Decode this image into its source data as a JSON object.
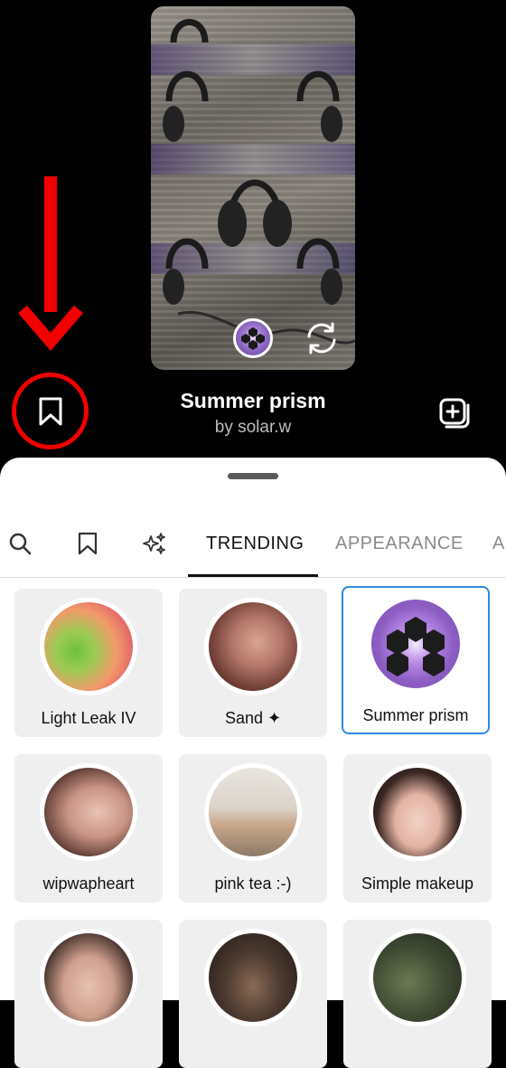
{
  "effect": {
    "title": "Summer prism",
    "author": "by solar.w"
  },
  "tabs": {
    "trending": "TRENDING",
    "appearance": "APPEARANCE",
    "partial": "A"
  },
  "tiles": [
    {
      "label": "Light Leak IV",
      "selected": false
    },
    {
      "label": "Sand ✦",
      "selected": false
    },
    {
      "label": "Summer prism",
      "selected": true
    },
    {
      "label": "wipwapheart",
      "selected": false
    },
    {
      "label": "pink tea :-)",
      "selected": false
    },
    {
      "label": "Simple makeup",
      "selected": false
    },
    {
      "label": "",
      "selected": false
    },
    {
      "label": "",
      "selected": false
    },
    {
      "label": "",
      "selected": false
    }
  ],
  "colors": {
    "annotation_red": "#f20000",
    "selected_border": "#2d8ad8",
    "sheet_bg": "#ffffff",
    "screen_bg": "#000000"
  },
  "icons": {
    "bookmark": "bookmark-icon",
    "flip_camera": "flip-camera-icon",
    "add_collection": "add-to-collection-icon",
    "search": "search-icon",
    "saved": "bookmark-icon",
    "sparkles": "sparkles-icon"
  }
}
